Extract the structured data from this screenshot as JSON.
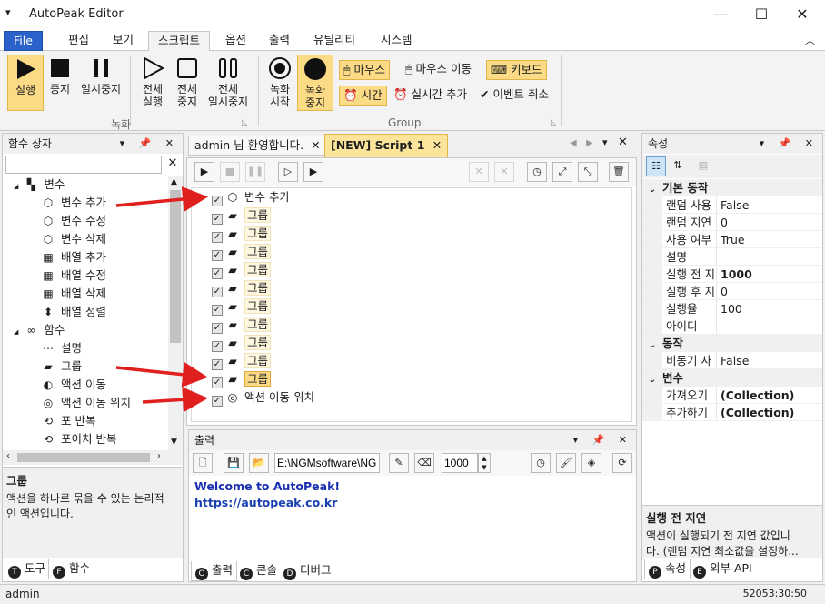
{
  "window": {
    "title": "AutoPeak Editor",
    "minimize": "—",
    "maximize": "☐",
    "close": "✕"
  },
  "ribbon_tabs": [
    "File",
    "편집",
    "보기",
    "스크립트",
    "옵션",
    "출력",
    "유틸리티",
    "시스템"
  ],
  "ribbon": {
    "rec_buttons": [
      "실행",
      "중지",
      "일시중지",
      "전체\n실행",
      "전체\n중지",
      "전체\n일시중지"
    ],
    "rec_group_label": "녹화",
    "rec_start": "녹화\n시작",
    "rec_stop": "녹화\n중지",
    "mouse": "마우스",
    "mouse_move": "마우스 이동",
    "keyboard": "키보드",
    "time": "시간",
    "realtime_add": "실시간 추가",
    "event_cancel": "이벤트 취소",
    "group_label": "Group"
  },
  "function_box": {
    "title": "함수 상자",
    "search_value": "",
    "tree": [
      {
        "label": "변수",
        "icon": "variable-category-icon",
        "level": 0
      },
      {
        "label": "변수 추가",
        "icon": "cube-icon",
        "level": 1
      },
      {
        "label": "변수 수정",
        "icon": "cube-icon",
        "level": 1
      },
      {
        "label": "변수 삭제",
        "icon": "cube-icon",
        "level": 1
      },
      {
        "label": "배열 추가",
        "icon": "array-icon",
        "level": 1
      },
      {
        "label": "배열 수정",
        "icon": "array-icon",
        "level": 1
      },
      {
        "label": "배열 삭제",
        "icon": "array-icon",
        "level": 1
      },
      {
        "label": "배열 정렬",
        "icon": "sort-icon",
        "level": 1
      },
      {
        "label": "함수",
        "icon": "infinity-icon",
        "level": 0
      },
      {
        "label": "설명",
        "icon": "ellipsis-icon",
        "level": 1
      },
      {
        "label": "그룹",
        "icon": "group-icon",
        "level": 1
      },
      {
        "label": "액션 이동",
        "icon": "action-move-icon",
        "level": 1
      },
      {
        "label": "액션 이동 위치",
        "icon": "target-icon",
        "level": 1
      },
      {
        "label": "포 반복",
        "icon": "loop-icon",
        "level": 1
      },
      {
        "label": "포이치 반복",
        "icon": "loop-icon",
        "level": 1
      }
    ],
    "desc_title": "그룹",
    "desc_text": "액션을 하나로 묶을 수 있는 논리적\n인 액션입니다.",
    "tabs": [
      {
        "key": "T",
        "label": "도구"
      },
      {
        "key": "F",
        "label": "함수"
      }
    ]
  },
  "doc_tabs": [
    "admin 님 환영합니다.",
    "[NEW] Script 1"
  ],
  "script_rows": [
    {
      "label": "변수 추가",
      "kind": "var",
      "selected": false
    },
    {
      "label": "그룹",
      "kind": "group",
      "selected": false
    },
    {
      "label": "그룹",
      "kind": "group",
      "selected": false
    },
    {
      "label": "그룹",
      "kind": "group",
      "selected": false
    },
    {
      "label": "그룹",
      "kind": "group",
      "selected": false
    },
    {
      "label": "그룹",
      "kind": "group",
      "selected": false
    },
    {
      "label": "그룹",
      "kind": "group",
      "selected": false
    },
    {
      "label": "그룹",
      "kind": "group",
      "selected": false
    },
    {
      "label": "그룹",
      "kind": "group",
      "selected": false
    },
    {
      "label": "그룹",
      "kind": "group",
      "selected": false
    },
    {
      "label": "그룹",
      "kind": "group",
      "selected": true
    },
    {
      "label": "액션 이동 위치",
      "kind": "target",
      "selected": false
    }
  ],
  "output": {
    "title": "출력",
    "path": "E:\\NGMsoftware\\NG",
    "count": "1000",
    "welcome": "Welcome to AutoPeak!",
    "link": "https://autopeak.co.kr",
    "tabs": [
      {
        "key": "O",
        "label": "출력"
      },
      {
        "key": "C",
        "label": "콘솔"
      },
      {
        "key": "D",
        "label": "디버그"
      }
    ]
  },
  "properties": {
    "title": "속성",
    "categories": [
      {
        "name": "기본 동작",
        "rows": [
          {
            "k": "랜덤 사용",
            "v": "False",
            "bold": false
          },
          {
            "k": "랜덤 지연",
            "v": "0",
            "bold": false
          },
          {
            "k": "사용 여부",
            "v": "True",
            "bold": false
          },
          {
            "k": "설명",
            "v": "",
            "bold": false
          },
          {
            "k": "실행 전 지",
            "v": "1000",
            "bold": true
          },
          {
            "k": "실행 후 지",
            "v": "0",
            "bold": false
          },
          {
            "k": "실행율",
            "v": "100",
            "bold": false
          },
          {
            "k": "아이디",
            "v": "",
            "bold": false
          }
        ]
      },
      {
        "name": "동작",
        "rows": [
          {
            "k": "비동기 사",
            "v": "False",
            "bold": false
          }
        ]
      },
      {
        "name": "변수",
        "rows": [
          {
            "k": "가져오기",
            "v": "(Collection)",
            "bold": true
          },
          {
            "k": "추가하기",
            "v": "(Collection)",
            "bold": true
          }
        ]
      }
    ],
    "desc_title": "실행 전 지연",
    "desc_text": "액션이 실행되기 전 지연 값입니\n다. (랜덤 지연 최소값을 설정하...",
    "tabs": [
      {
        "key": "P",
        "label": "속성"
      },
      {
        "key": "E",
        "label": "외부 API"
      }
    ]
  },
  "status": {
    "user": "admin",
    "time": "52053:30:50"
  },
  "colors": {
    "file_tab": "#2b62c9",
    "highlight": "#fbdb86",
    "arrow": "#e0201e",
    "link": "#1a3fb3",
    "welcome": "#1a2fb0"
  }
}
